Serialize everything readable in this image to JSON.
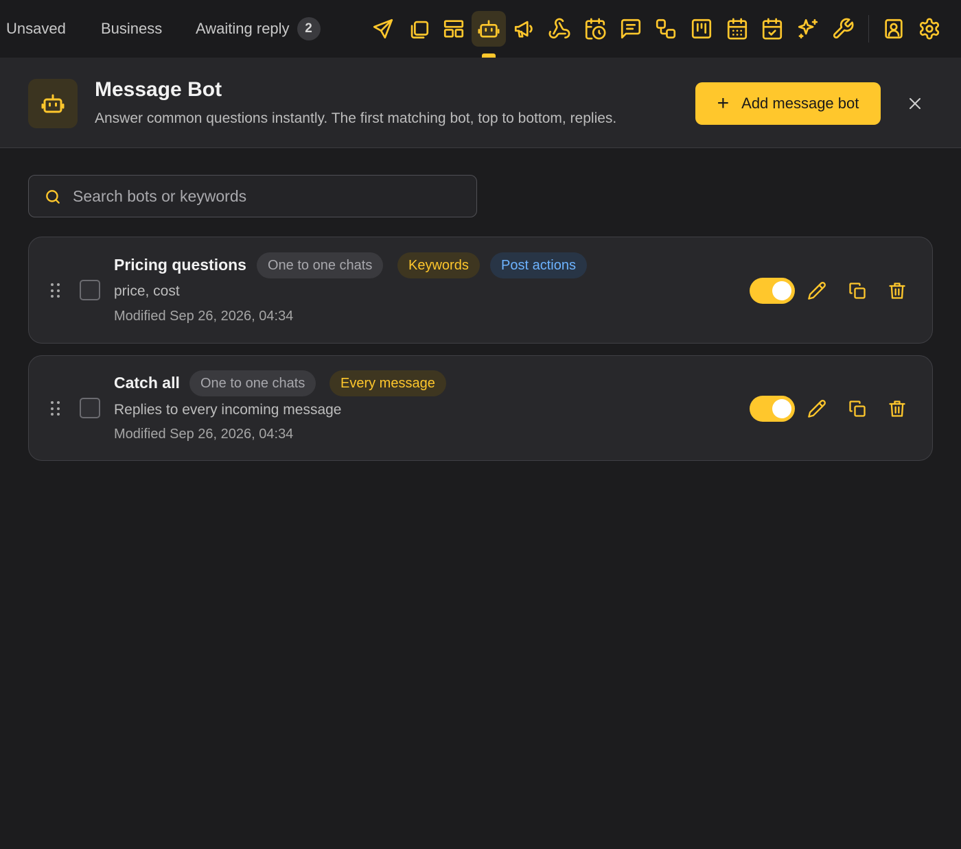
{
  "topbar": {
    "tabs": [
      {
        "label": "Unsaved"
      },
      {
        "label": "Business"
      },
      {
        "label": "Awaiting reply",
        "count": "2"
      }
    ],
    "tools": [
      "send-icon",
      "copy-icon",
      "layout-icon",
      "bot-icon",
      "megaphone-icon",
      "webhook-icon",
      "calendar-clock-icon",
      "message-icon",
      "workflow-icon",
      "kanban-icon",
      "calendar-grid-icon",
      "calendar-check-icon",
      "sparkles-icon",
      "wrench-icon",
      "contact-icon",
      "settings-icon"
    ],
    "active_tool": "bot-icon"
  },
  "header": {
    "title": "Message Bot",
    "subtitle": "Answer common questions instantly. The first matching bot, top to bottom, replies.",
    "add_label": "Add message bot"
  },
  "search": {
    "placeholder": "Search bots or keywords",
    "value": ""
  },
  "bots": [
    {
      "name": "Pricing questions",
      "chips": [
        {
          "label": "One to one chats",
          "style": "gray"
        },
        {
          "label": "Keywords",
          "style": "yellow"
        },
        {
          "label": "Post actions",
          "style": "blue"
        }
      ],
      "description": "price, cost",
      "modified": "Modified Sep 26, 2026, 04:34",
      "enabled": true,
      "checked": false
    },
    {
      "name": "Catch all",
      "chips": [
        {
          "label": "One to one chats",
          "style": "gray"
        },
        {
          "label": "Every message",
          "style": "yellow"
        }
      ],
      "description": "Replies to every incoming message",
      "modified": "Modified Sep 26, 2026, 04:34",
      "enabled": true,
      "checked": false
    }
  ],
  "colors": {
    "accent": "#ffc72c",
    "background": "#1c1c1e",
    "panel": "#27272a",
    "chip_blue_text": "#6db3ff"
  }
}
